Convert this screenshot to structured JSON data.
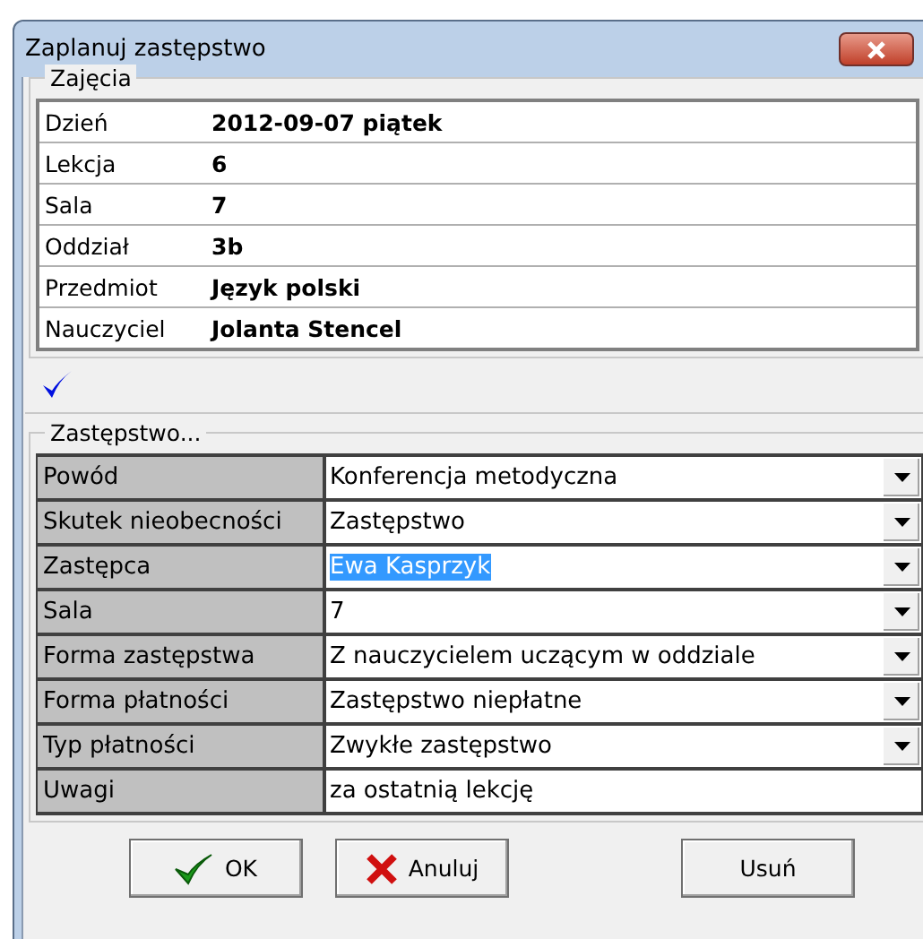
{
  "window": {
    "title": "Zaplanuj zastępstwo"
  },
  "lesson": {
    "legend": "Zajęcia",
    "rows": [
      {
        "label": "Dzień",
        "value": "2012-09-07 piątek"
      },
      {
        "label": "Lekcja",
        "value": "6"
      },
      {
        "label": "Sala",
        "value": "7"
      },
      {
        "label": "Oddział",
        "value": "3b"
      },
      {
        "label": "Przedmiot",
        "value": "Język polski"
      },
      {
        "label": "Nauczyciel",
        "value": "Jolanta Stencel"
      }
    ]
  },
  "substitution": {
    "legend": "Zastępstwo...",
    "rows": [
      {
        "label": "Powód",
        "value": "Konferencja metodyczna",
        "kind": "dropdown",
        "highlighted": false
      },
      {
        "label": "Skutek nieobecności",
        "value": "Zastępstwo",
        "kind": "dropdown",
        "highlighted": false
      },
      {
        "label": "Zastępca",
        "value": "Ewa Kasprzyk",
        "kind": "dropdown",
        "highlighted": true
      },
      {
        "label": "Sala",
        "value": "7",
        "kind": "dropdown",
        "highlighted": false
      },
      {
        "label": "Forma zastępstwa",
        "value": "Z nauczycielem uczącym w oddziale",
        "kind": "dropdown",
        "highlighted": false
      },
      {
        "label": "Forma płatności",
        "value": "Zastępstwo niepłatne",
        "kind": "dropdown",
        "highlighted": false
      },
      {
        "label": "Typ płatności",
        "value": "Zwykłe zastępstwo",
        "kind": "dropdown",
        "highlighted": false
      },
      {
        "label": "Uwagi",
        "value": "za ostatnią lekcję",
        "kind": "text",
        "highlighted": false
      }
    ]
  },
  "buttons": [
    {
      "label": "OK",
      "kind": "ok"
    },
    {
      "label": "Anuluj",
      "kind": "cancel"
    },
    {
      "label": "Usuń",
      "kind": "plain"
    }
  ]
}
